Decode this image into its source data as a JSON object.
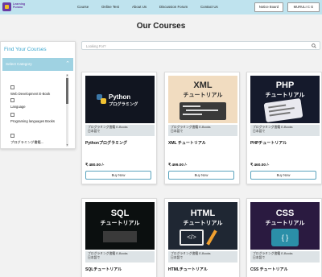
{
  "header": {
    "logo_text_1": "Learning",
    "logo_text_2": "Purana",
    "nav": [
      "Course",
      "Online Test",
      "About Us",
      "Discussion Forum",
      "Contact Us"
    ],
    "notice_board_label": "Notice Board",
    "user_label": "MURULI C G"
  },
  "page": {
    "title": "Our Courses"
  },
  "sidebar": {
    "title": "Find Your Courses",
    "select_label": "Select Category",
    "categories": [
      "Web Development E-Book",
      "Language",
      "Programing languages Books",
      "プログラミング書籍..."
    ]
  },
  "search": {
    "placeholder": "Looking For?"
  },
  "courses": [
    {
      "thumb_line1": "Python",
      "thumb_line2": "プログラミング",
      "tag_line1": "プログラミング書籍 E-Books",
      "tag_line2": "日本語で",
      "title": "Pythonプログラミング",
      "price": "₹ 480.00 /-",
      "buy_label": "Buy Now"
    },
    {
      "thumb_line1": "XML",
      "thumb_line2": "チュートリアル",
      "tag_line1": "プログラミング書籍 E-Books",
      "tag_line2": "日本語で",
      "title": "XML チュートリアル",
      "price": "₹ 499.00 /-",
      "buy_label": "Buy Now"
    },
    {
      "thumb_line1": "PHP",
      "thumb_line2": "チュートリアル",
      "tag_line1": "プログラミング書籍 E-Books",
      "tag_line2": "日本語で",
      "title": "PHPチュートリアル",
      "price": "₹ 460.00 /-",
      "buy_label": "Buy Now"
    },
    {
      "thumb_line1": "SQL",
      "thumb_line2": "チュートリアル",
      "tag_line1": "プログラミング書籍 E-Books",
      "tag_line2": "日本語で",
      "title": "SQLチュートリアル",
      "price": "",
      "buy_label": ""
    },
    {
      "thumb_line1": "HTML",
      "thumb_line2": "チュートリアル",
      "tag_line1": "プログラミング書籍 E-Books",
      "tag_line2": "日本語で",
      "title": "HTMLチュートリアル",
      "price": "",
      "buy_label": ""
    },
    {
      "thumb_line1": "CSS",
      "thumb_line2": "チュートリアル",
      "tag_line1": "プログラミング書籍 E-Books",
      "tag_line2": "日本語で",
      "title": "CSS チュートリアル",
      "price": "",
      "buy_label": ""
    }
  ]
}
